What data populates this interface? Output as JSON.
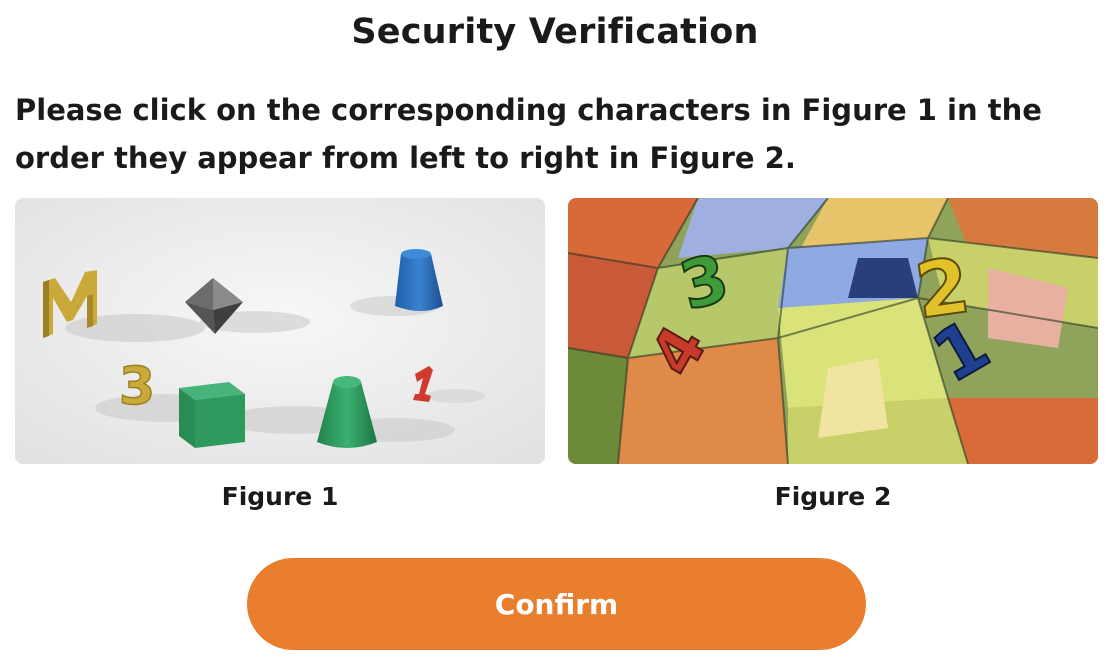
{
  "title": "Security Verification",
  "instruction": "Please click on the corresponding characters in Figure 1 in the order they appear from left to right in Figure 2.",
  "figure1": {
    "caption": "Figure 1",
    "objects": [
      {
        "kind": "letter",
        "char": "M",
        "color": "#c9a93a"
      },
      {
        "kind": "shape",
        "name": "octahedron",
        "color": "#6b6b6b"
      },
      {
        "kind": "shape",
        "name": "cone",
        "color": "#2f6fb8"
      },
      {
        "kind": "digit",
        "char": "3",
        "color": "#c9a93a"
      },
      {
        "kind": "shape",
        "name": "cube",
        "color": "#2e9a5e"
      },
      {
        "kind": "shape",
        "name": "cone",
        "color": "#2e9a5e"
      },
      {
        "kind": "digit",
        "char": "1",
        "color": "#d13a2f"
      }
    ]
  },
  "figure2": {
    "caption": "Figure 2",
    "characters": [
      {
        "char": "4",
        "color": "#c83a2a"
      },
      {
        "char": "3",
        "color": "#3f9a3a"
      },
      {
        "char": "2",
        "color": "#e2c22a"
      },
      {
        "char": "1",
        "color": "#1f3f8f"
      }
    ]
  },
  "confirm_label": "Confirm",
  "colors": {
    "accent": "#e97e2e",
    "text": "#1a1a1a",
    "background": "#ffffff"
  }
}
